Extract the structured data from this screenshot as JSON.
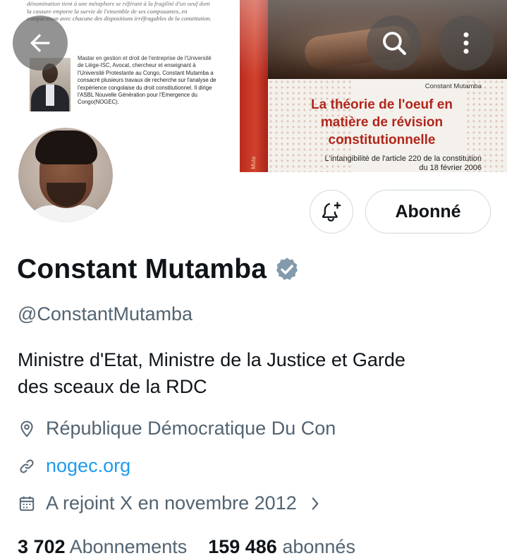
{
  "banner": {
    "back_cover_top_text": "dénomination tient à une métaphore se référant à la fragilité d'un oeuf dont la cassure emporte la survie de l'ensemble de ses composantes, en comparaison avec chacune des dispositions irréfragables de la constitution.",
    "author_bio": "Mastar en gestion et droit de l'entreprise de l'Université de Liège-ISC, Avocat, chercheur et enseignant à l'Université Protestante au Congo, Constant Mutamba a consacré plusieurs travaux de recherche sur l'analyse de l'expérience congolaise du droit constitutionnel. Il dirige l'ASBL Nouvelle Génération pour l'Emergence du Congo(NOGEC).",
    "spine_text": "Muta",
    "book_author": "Constant Mutamba",
    "book_title_line1": "La théorie de l'oeuf en",
    "book_title_line2": "matière de révision",
    "book_title_line3": "constitutionnelle",
    "book_subtitle_line1": "L'intangibilité de l'article 220 de la constitution",
    "book_subtitle_line2": "du 18 février 2006"
  },
  "nav": {
    "back_icon": "arrow-left-icon",
    "search_icon": "search-icon",
    "more_icon": "more-vertical-icon"
  },
  "actions": {
    "notify_icon": "bell-plus-icon",
    "follow_label": "Abonné"
  },
  "profile": {
    "display_name": "Constant Mutamba",
    "verified_icon": "verified-badge-icon",
    "handle": "@ConstantMutamba",
    "bio_line1": "Ministre d'Etat, Ministre de la Justice et Garde",
    "bio_line2": "des sceaux de la RDC",
    "location": "République Démocratique Du Con",
    "website": "nogec.org",
    "joined": "A rejoint X en novembre 2012"
  },
  "stats": {
    "following_count": "3 702",
    "following_label": "Abonnements",
    "followers_count": "159 486",
    "followers_label": "abonnés"
  },
  "colors": {
    "text_primary": "#0f1419",
    "text_secondary": "#536471",
    "link": "#1d9bf0",
    "verified_badge": "#829aab",
    "book_title_red": "#b1261b"
  }
}
